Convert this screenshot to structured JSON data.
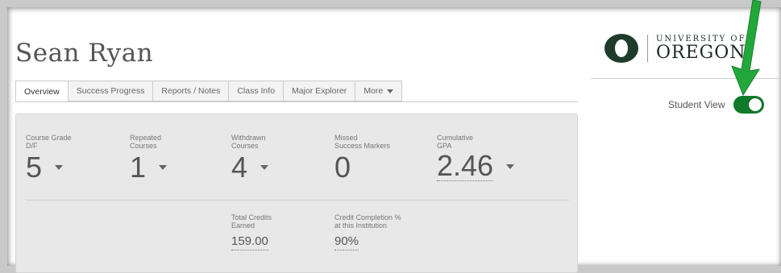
{
  "student": {
    "name": "Sean Ryan"
  },
  "tabs": [
    {
      "label": "Overview",
      "active": true
    },
    {
      "label": "Success Progress"
    },
    {
      "label": "Reports / Notes"
    },
    {
      "label": "Class Info"
    },
    {
      "label": "Major Explorer"
    },
    {
      "label": "More"
    }
  ],
  "metrics": {
    "course_grade": {
      "label1": "Course Grade",
      "label2": "D/F",
      "value": "5"
    },
    "repeated": {
      "label1": "Repeated",
      "label2": "Courses",
      "value": "1"
    },
    "withdrawn": {
      "label1": "Withdrawn",
      "label2": "Courses",
      "value": "4"
    },
    "missed": {
      "label1": "Missed",
      "label2": "Success Markers",
      "value": "0"
    },
    "gpa": {
      "label1": "Cumulative",
      "label2": "GPA",
      "value": "2.46"
    }
  },
  "secondary": {
    "credits": {
      "label1": "Total Credits",
      "label2": "Earned",
      "value": "159.00"
    },
    "completion": {
      "label1": "Credit Completion %",
      "label2": "at this Institution",
      "value": "90%"
    }
  },
  "logo": {
    "top": "UNIVERSITY OF",
    "bottom": "OREGON"
  },
  "student_view": {
    "label": "Student View",
    "on": true
  },
  "colors": {
    "toggle": "#0f7a2a",
    "arrow": "#22a83a",
    "logo_o": "#1f3b2c"
  }
}
